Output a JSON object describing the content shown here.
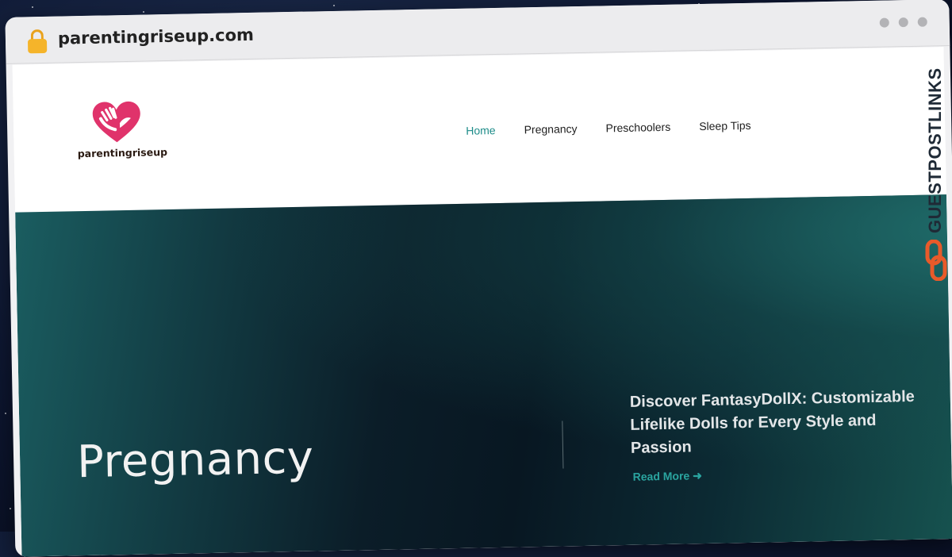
{
  "browser": {
    "url": "parentingriseup.com"
  },
  "site": {
    "logo_text": "parentingriseup",
    "nav": [
      {
        "label": "Home",
        "active": true
      },
      {
        "label": "Pregnancy",
        "active": false
      },
      {
        "label": "Preschoolers",
        "active": false
      },
      {
        "label": "Sleep Tips",
        "active": false
      }
    ]
  },
  "hero": {
    "title": "Pregnancy",
    "post_title": "Discover FantasyDollX: Customizable Lifelike Dolls for Every Style and Passion",
    "read_more": "Read More ➜"
  },
  "badge": {
    "text": "GUESTPOSTLINKS",
    "icon": "chain-link-icon"
  },
  "colors": {
    "accent": "#1f8d8a",
    "read_more": "#2aa49f",
    "logo_heart": "#e0336b",
    "badge_icon": "#e85a2a"
  }
}
